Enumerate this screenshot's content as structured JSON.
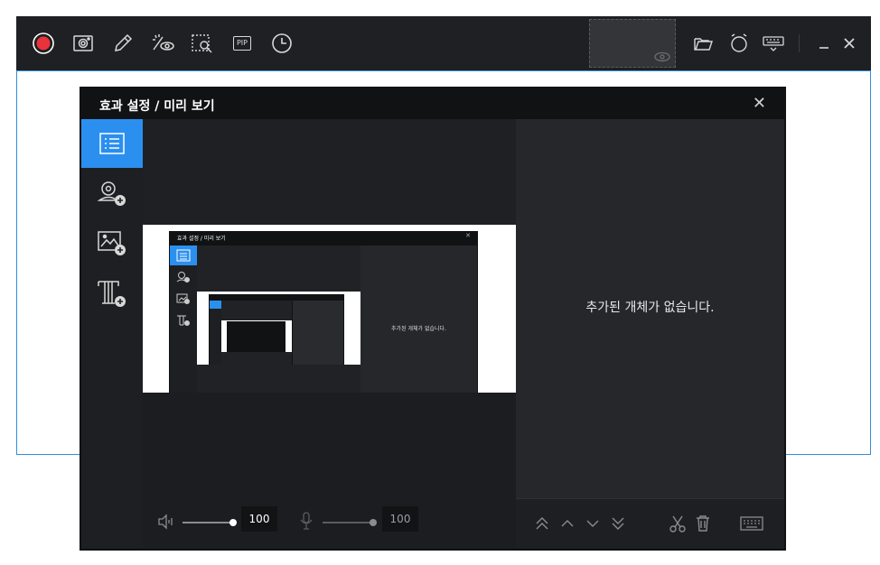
{
  "toolbar": {
    "pip_label": "PIP",
    "icons": [
      "record-icon",
      "screenshot-icon",
      "pencil-icon",
      "effects-icon",
      "zoom-capture-icon",
      "pip-icon",
      "timer-icon",
      "folder-icon",
      "alarm-icon",
      "keyboard-icon",
      "minimize-icon",
      "close-icon"
    ]
  },
  "dialog": {
    "title": "효과 설정 / 미리 보기",
    "close_glyph": "✕",
    "empty_message": "추가된 개체가 없습니다.",
    "speaker_volume": "100",
    "mic_volume": "100",
    "speaker_level": 1.0,
    "mic_level": 1.0
  },
  "nested_preview": {
    "title": "효과 설정 / 미리 보기",
    "empty_message": "추가된 개체가 없습니다."
  },
  "colors": {
    "accent": "#2b8ff0",
    "record": "#e8333a",
    "frame": "#2f8fe0"
  }
}
